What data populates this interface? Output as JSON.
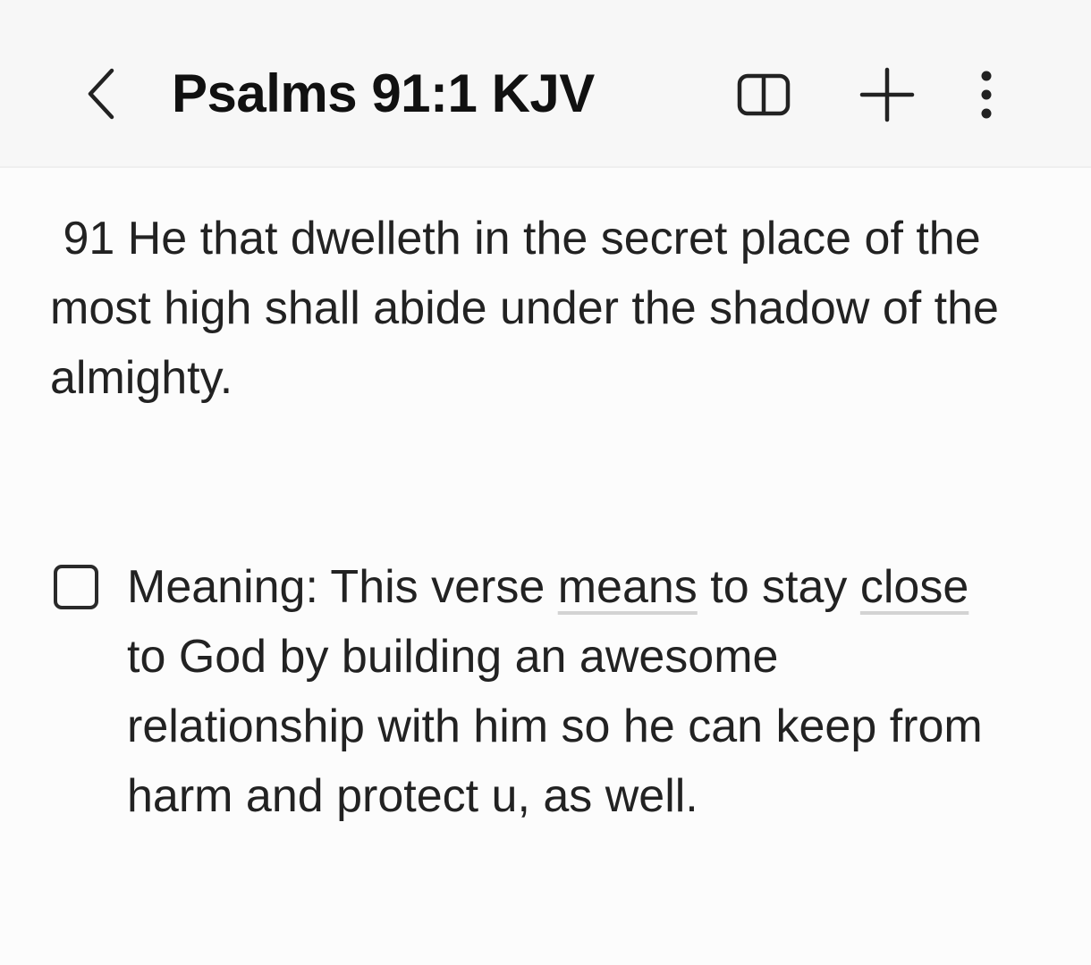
{
  "header": {
    "title": "Psalms 91:1 KJV",
    "back_icon": "chevron-left-icon",
    "reader_icon": "reading-mode-icon",
    "add_icon": "plus-icon",
    "more_icon": "more-vertical-icon"
  },
  "note": {
    "verse": " 91 He that dwelleth in the secret place of the most high shall abide under the shadow of the almighty.",
    "checklist": {
      "checked": false,
      "segments": [
        {
          "text": "Meaning:  This verse ",
          "flag": false
        },
        {
          "text": "means",
          "flag": true
        },
        {
          "text": " to stay ",
          "flag": false
        },
        {
          "text": "close",
          "flag": true
        },
        {
          "text": " to God by building an awesome relationship with him so he can keep from harm and protect u, as well.",
          "flag": false
        }
      ]
    }
  },
  "colors": {
    "background": "#fcfcfc",
    "header_background": "#f7f7f7",
    "text": "#222222",
    "spellcheck_underline": "#d3d3d3"
  }
}
